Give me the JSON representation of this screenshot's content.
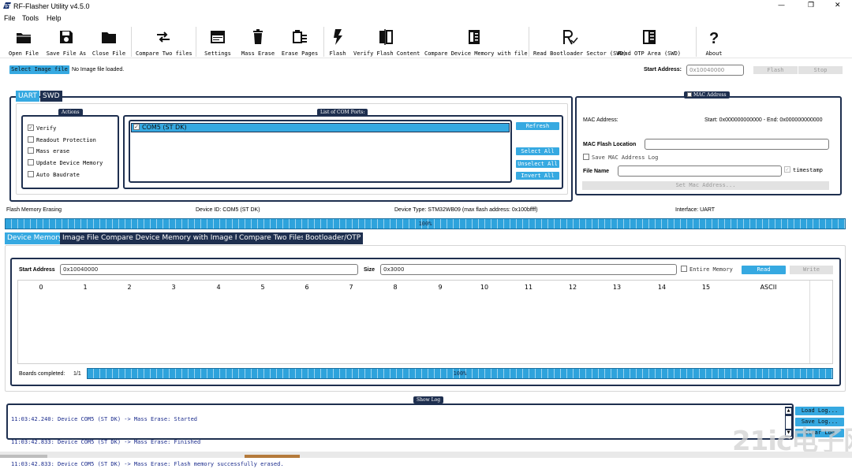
{
  "window": {
    "title": "RF-Flasher Utility v4.5.0"
  },
  "menu": [
    "File",
    "Tools",
    "Help"
  ],
  "toolbar": [
    {
      "label": "Open File",
      "icon": "folder-icon"
    },
    {
      "label": "Save File As",
      "icon": "save-icon"
    },
    {
      "label": "Close File",
      "icon": "close-file-icon"
    },
    {
      "label": "Compare Two files",
      "icon": "compare-icon"
    },
    {
      "label": "Settings",
      "icon": "settings-icon"
    },
    {
      "label": "Mass Erase",
      "icon": "trash-icon"
    },
    {
      "label": "Erase Pages",
      "icon": "erase-pages-icon"
    },
    {
      "label": "Flash",
      "icon": "lightning-icon"
    },
    {
      "label": "Verify Flash Content",
      "icon": "verify-icon"
    },
    {
      "label": "Compare Device Memory with file",
      "icon": "compare-device-icon"
    },
    {
      "label": "Read Bootloader Sector (SWD)",
      "icon": "read-bootloader-icon"
    },
    {
      "label": "Read OTP Area (SWD)",
      "icon": "read-otp-icon"
    },
    {
      "label": "About",
      "icon": "question-icon"
    }
  ],
  "image_file": {
    "select_label": "Select Image file",
    "status": "No Image file loaded."
  },
  "flash_bar": {
    "start_address_label": "Start Address:",
    "start_address_value": "0x10040000",
    "flash_label": "Flash",
    "stop_label": "Stop"
  },
  "interface_tabs": [
    "UART",
    "SWD"
  ],
  "actions": {
    "caption": "Actions",
    "items": [
      {
        "label": "Verify",
        "checked": true
      },
      {
        "label": "Readout Protection",
        "checked": false
      },
      {
        "label": "Mass erase",
        "checked": false
      },
      {
        "label": "Update Device Memory",
        "checked": false
      },
      {
        "label": "Auto Baudrate",
        "checked": false
      }
    ]
  },
  "com_ports": {
    "caption": "List of COM Ports:",
    "items": [
      {
        "label": "COM5 (ST DK)",
        "checked": true
      }
    ],
    "refresh_label": "Refresh",
    "select_all_label": "Select All",
    "unselect_all_label": "Unselect All",
    "invert_all_label": "Invert All"
  },
  "mac": {
    "caption": "MAC Address",
    "address_label": "MAC Address:",
    "range": "Start: 0x000000000000 - End: 0x000000000000",
    "flash_location_label": "MAC Flash Location",
    "save_log_label": "Save MAC Address Log",
    "file_name_label": "File Name",
    "timestamp_label": "timestamp",
    "set_button_label": "Set Mac Address..."
  },
  "status": {
    "operation": "Flash Memory Erasing",
    "device_id": "Device ID:  COM5 (ST DK)",
    "device_type": "Device Type:  STM32WB09 (max flash address: 0x100bffff)",
    "interface": "Interface:  UART",
    "progress_pct": "100%",
    "progress_value": 1.0
  },
  "main_tabs": [
    "Device Memory",
    "Image File",
    "Compare Device Memory with Image File",
    "Compare Two Files",
    "Bootloader/OTP"
  ],
  "device_memory": {
    "start_address_label": "Start Address",
    "start_address_value": "0x10040000",
    "size_label": "Size",
    "size_value": "0x3000",
    "entire_memory_label": "Entire Memory",
    "read_label": "Read",
    "write_label": "Write",
    "columns": [
      "0",
      "1",
      "2",
      "3",
      "4",
      "5",
      "6",
      "7",
      "8",
      "9",
      "10",
      "11",
      "12",
      "13",
      "14",
      "15",
      "ASCII"
    ],
    "boards_label": "Boards completed:",
    "boards_value": "1/1",
    "progress_pct": "100%",
    "progress_value": 1.0
  },
  "log": {
    "caption": "Show Log",
    "lines": [
      "11:03:42.240: Device COM5 (ST DK) -> Mass Erase: Started",
      "11:03:42.833: Device COM5 (ST DK) -> Mass Erase: Finished",
      "11:03:42.833: Device COM5 (ST DK) -> Mass Erase: Flash memory successfully erased."
    ],
    "load_label": "Load Log...",
    "save_label": "Save Log...",
    "clear_label": "Clear Log"
  },
  "window_controls": [
    "—",
    "❐",
    "✕"
  ],
  "watermark": "21ic电子网",
  "colors": {
    "accent": "#36a9e1",
    "navy": "#1e2f4f",
    "log_text": "#1a2b8c"
  }
}
